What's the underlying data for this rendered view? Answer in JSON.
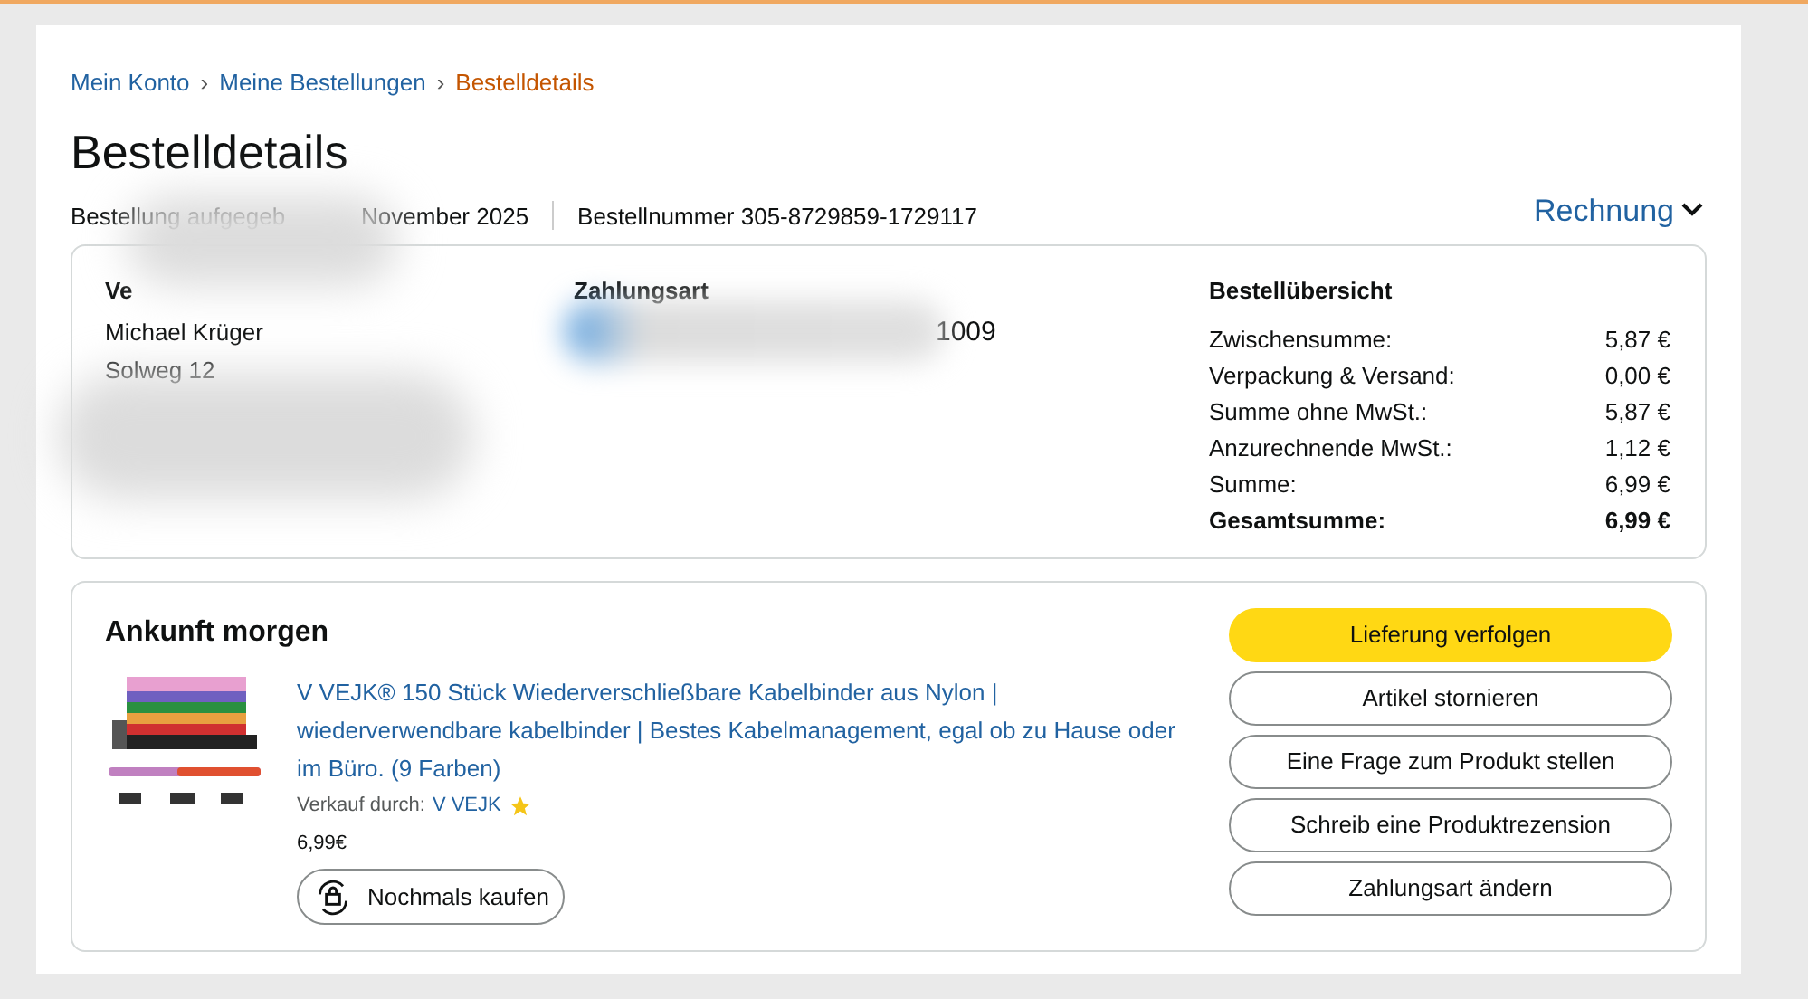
{
  "breadcrumb": [
    {
      "label": "Mein Konto",
      "current": false
    },
    {
      "label": "Meine Bestellungen",
      "current": false
    },
    {
      "label": "Bestelldetails",
      "current": true
    }
  ],
  "breadcrumb_separator": "›",
  "title": "Bestelldetails",
  "order_date_prefix": "Bestellung aufgegeb",
  "order_date_suffix": "November 2025",
  "order_number": "Bestellnummer 305-8729859-1729117",
  "invoice_link": "Rechnung",
  "shipping": {
    "heading": "Ve",
    "lines": [
      "Michael Krüger",
      "Solweg 12"
    ]
  },
  "payment": {
    "heading": "Zahlungsart",
    "card_suffix": "1009"
  },
  "summary": {
    "heading": "Bestellübersicht",
    "rows": [
      {
        "label": "Zwischensumme:",
        "value": "5,87 €",
        "bold": false
      },
      {
        "label": "Verpackung & Versand:",
        "value": "0,00 €",
        "bold": false
      },
      {
        "label": "Summe ohne MwSt.:",
        "value": "5,87 €",
        "bold": false
      },
      {
        "label": "Anzurechnende MwSt.:",
        "value": "1,12 €",
        "bold": false
      },
      {
        "label": "Summe:",
        "value": "6,99 €",
        "bold": false
      },
      {
        "label": "Gesamtsumme:",
        "value": "6,99 €",
        "bold": true
      }
    ]
  },
  "shipment": {
    "heading": "Ankunft morgen",
    "product": {
      "kind": "picture",
      "title": "V VEJK® 150 Stück Wiederverschließbare Kabelbinder aus Nylon | wiederverwendbare kabelbinder | Bestes Kabelmanagement, egal ob zu Hause oder im Büro. (9 Farben)",
      "seller_label": "Verkauf durch:",
      "seller": "V VEJK",
      "price": "6,99€",
      "rebuy": "Nochmals kaufen"
    },
    "actions": [
      {
        "label": "Lieferung verfolgen",
        "primary": true
      },
      {
        "label": "Artikel stornieren",
        "primary": false
      },
      {
        "label": "Eine Frage zum Produkt stellen",
        "primary": false
      },
      {
        "label": "Schreib eine Produktrezension",
        "primary": false
      },
      {
        "label": "Zahlungsart ändern",
        "primary": false
      }
    ]
  }
}
